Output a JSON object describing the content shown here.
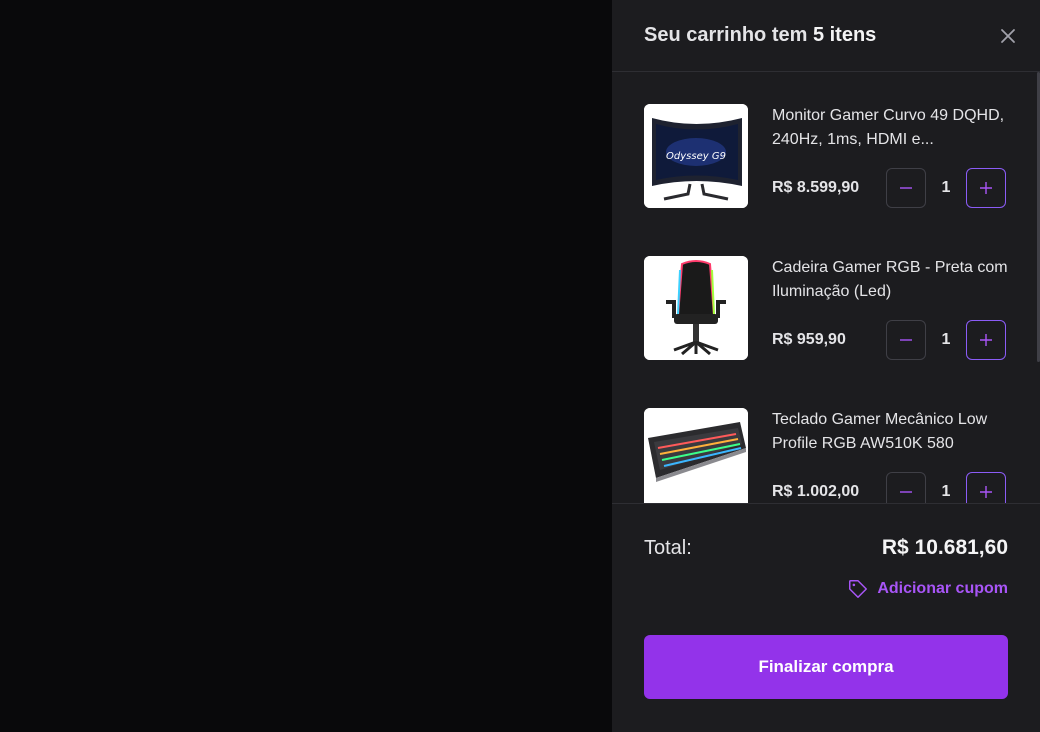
{
  "cart": {
    "title_prefix": "Seu carrinho tem ",
    "title_count": "5 itens",
    "items": [
      {
        "name": "Monitor Gamer Curvo 49 DQHD, 240Hz, 1ms, HDMI e...",
        "price": "R$ 8.599,90",
        "quantity": "1",
        "image_text": "Odyssey G9"
      },
      {
        "name": "Cadeira Gamer RGB - Preta com Iluminação (Led)",
        "price": "R$ 959,90",
        "quantity": "1"
      },
      {
        "name": "Teclado Gamer Mecânico Low Profile RGB AW510K 580",
        "price": "R$ 1.002,00",
        "quantity": "1"
      }
    ]
  },
  "footer": {
    "total_label": "Total:",
    "total_value": "R$ 10.681,60",
    "coupon_label": "Adicionar cupom",
    "checkout_label": "Finalizar compra"
  },
  "colors": {
    "accent": "#9333ea",
    "accent_text": "#a855f7",
    "panel": "#1c1c1f",
    "backdrop": "#09090b"
  },
  "icons": [
    "close-icon",
    "minus-icon",
    "plus-icon",
    "tag-icon"
  ]
}
